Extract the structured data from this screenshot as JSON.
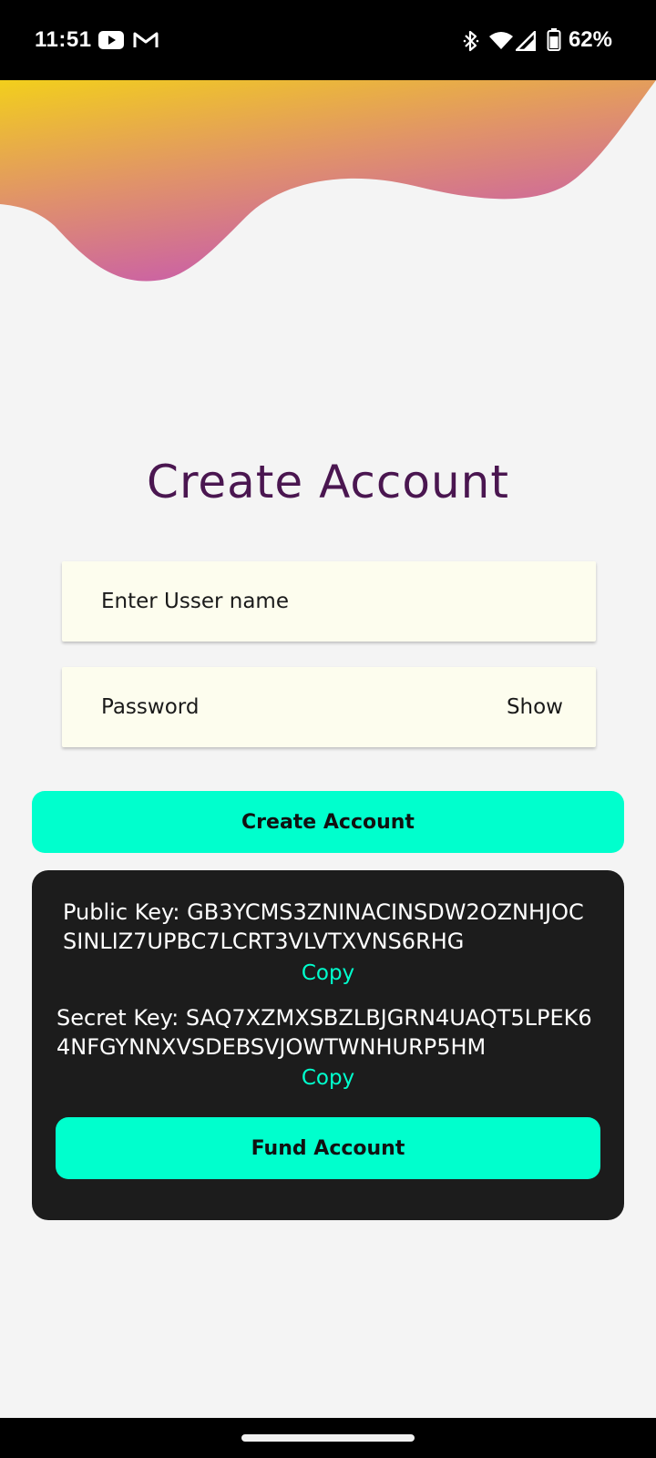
{
  "status_bar": {
    "time": "11:51",
    "battery": "62%",
    "icons": [
      "youtube-icon",
      "gmail-icon",
      "bluetooth-icon",
      "wifi-icon",
      "signal-icon",
      "battery-icon"
    ]
  },
  "page": {
    "title": "Create Account"
  },
  "form": {
    "username_placeholder": "Enter Usser name",
    "password_placeholder": "Password",
    "show_label": "Show",
    "create_button": "Create Account"
  },
  "keys": {
    "public_key": "Public Key: GB3YCMS3ZNINACINSDW2OZNHJOCSINLIZ7UPBC7LCRT3VLVTXVNS6RHG",
    "secret_key": "Secret Key: SAQ7XZMXSBZLBJGRN4UAQT5LPEK64NFGYNNXVSDEBSVJOWTWNHURP5HM",
    "copy_label": "Copy",
    "fund_button": "Fund Account"
  },
  "colors": {
    "accent": "#00ffcd",
    "title": "#4a1650",
    "card_bg": "#1c1c1c",
    "field_bg": "#fdfdee",
    "gradient_start": "#f2cf1c",
    "gradient_end": "#c24dbd"
  }
}
